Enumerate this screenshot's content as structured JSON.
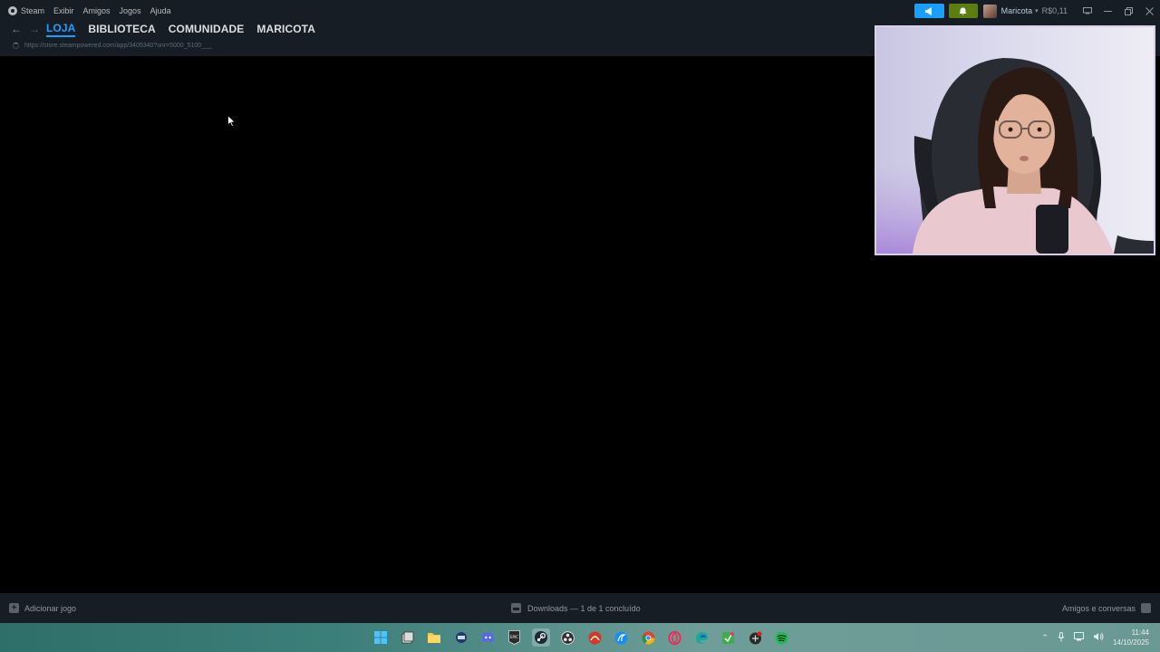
{
  "menu": {
    "steam": "Steam",
    "exibir": "Exibir",
    "amigos": "Amigos",
    "jogos": "Jogos",
    "ajuda": "Ajuda"
  },
  "account": {
    "username": "Maricota",
    "balance": "R$0,11"
  },
  "nav": {
    "tabs": [
      "LOJA",
      "BIBLIOTECA",
      "COMUNIDADE",
      "MARICOTA"
    ],
    "active_tab": "LOJA",
    "url": "https://store.steampowered.com/app/3405340?snr=5000_5100___"
  },
  "bottom": {
    "add_game": "Adicionar jogo",
    "downloads": "Downloads — 1 de 1 concluído",
    "friends": "Amigos e conversas"
  },
  "taskbar": {
    "icons": [
      "windows-start",
      "task-view",
      "file-explorer",
      "app-unknown",
      "discord",
      "epic-games",
      "steam",
      "obs",
      "app-red",
      "battle-net",
      "chrome",
      "opera-gx",
      "edge",
      "app-green",
      "app-badge",
      "spotify"
    ]
  },
  "clock": {
    "time": "11:44",
    "date": "14/10/2025"
  },
  "colors": {
    "accent": "#1a9fff",
    "notification": "#5c7e10",
    "chrome_bg": "#171d25",
    "content_bg": "#000000"
  }
}
